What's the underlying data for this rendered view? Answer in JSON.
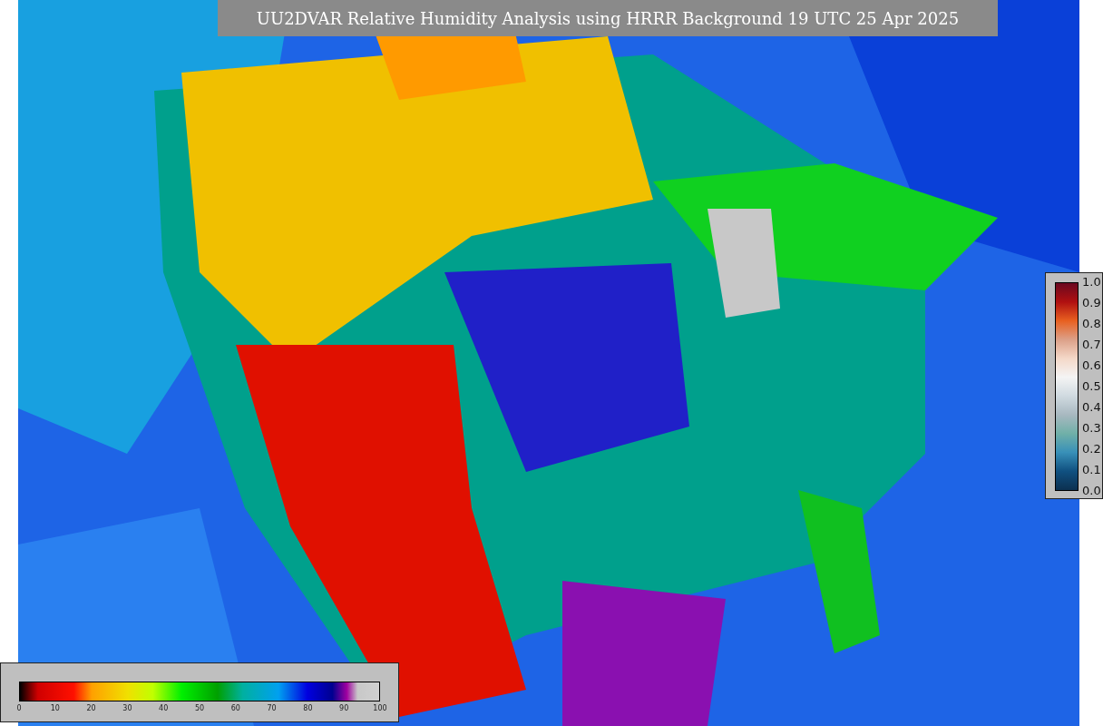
{
  "title": "UU2DVAR Relative Humidity Analysis using HRRR Background 19 UTC 25 Apr 2025",
  "right_colorbar": {
    "ticks": [
      "1.0",
      "0.9",
      "0.8",
      "0.7",
      "0.6",
      "0.5",
      "0.4",
      "0.3",
      "0.2",
      "0.1",
      "0.0"
    ]
  },
  "bottom_colorbar": {
    "ticks": [
      "0",
      "10",
      "20",
      "30",
      "40",
      "50",
      "60",
      "70",
      "80",
      "90",
      "100"
    ]
  }
}
